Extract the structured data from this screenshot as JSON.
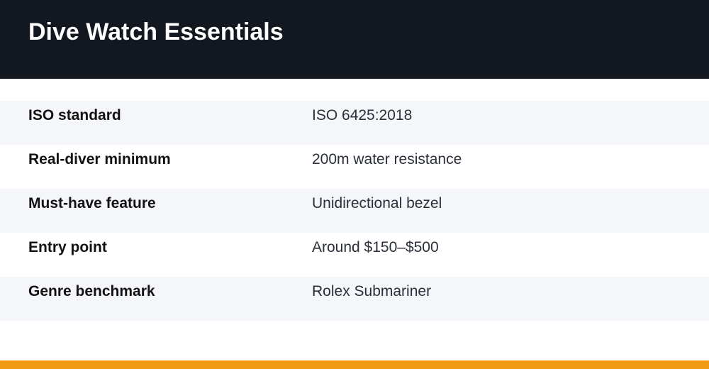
{
  "header": {
    "title": "Dive Watch Essentials"
  },
  "specs": [
    {
      "label": "ISO standard",
      "value": "ISO 6425:2018"
    },
    {
      "label": "Real-diver minimum",
      "value": "200m water resistance"
    },
    {
      "label": "Must-have feature",
      "value": "Unidirectional bezel"
    },
    {
      "label": "Entry point",
      "value": "Around $150–$500"
    },
    {
      "label": "Genre benchmark",
      "value": "Rolex Submariner"
    }
  ],
  "colors": {
    "header_background": "#131720",
    "row_shade": "#f5f6fa",
    "accent": "#f29a12"
  }
}
